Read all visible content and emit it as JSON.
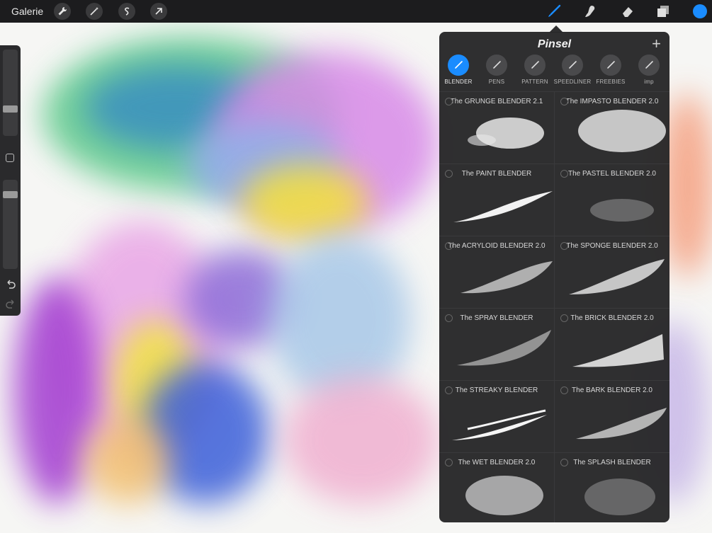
{
  "topbar": {
    "gallery_label": "Galerie",
    "tools_left": [
      "wrench-icon",
      "magic-wand-icon",
      "selection-icon",
      "transform-arrow-icon"
    ],
    "tools_right": [
      "brush-icon",
      "smudge-icon",
      "eraser-icon",
      "layers-icon"
    ],
    "color": "#1a8cff"
  },
  "sidebar": {
    "size_slider_value": 0.35,
    "opacity_slider_value": 0.15,
    "undo_icon": "undo-icon",
    "redo_icon": "redo-icon"
  },
  "panel": {
    "title": "Pinsel",
    "add_icon": "plus-icon",
    "sets": [
      {
        "label": "BLENDER",
        "active": true
      },
      {
        "label": "PENS",
        "active": false
      },
      {
        "label": "PATTERN",
        "active": false
      },
      {
        "label": "SPEEDLINER",
        "active": false
      },
      {
        "label": "FREEBIES",
        "active": false
      },
      {
        "label": "imp",
        "active": false
      }
    ],
    "brushes": [
      {
        "name": "The GRUNGE BLENDER 2.1"
      },
      {
        "name": "The IMPASTO BLENDER 2.0"
      },
      {
        "name": "The PAINT BLENDER"
      },
      {
        "name": "The PASTEL BLENDER 2.0"
      },
      {
        "name": "The ACRYLOID BLENDER 2.0"
      },
      {
        "name": "The SPONGE BLENDER 2.0"
      },
      {
        "name": "The SPRAY BLENDER"
      },
      {
        "name": "The BRICK BLENDER 2.0"
      },
      {
        "name": "The STREAKY BLENDER"
      },
      {
        "name": "The BARK BLENDER 2.0"
      },
      {
        "name": "The WET BLENDER 2.0"
      },
      {
        "name": "The SPLASH BLENDER"
      }
    ]
  }
}
